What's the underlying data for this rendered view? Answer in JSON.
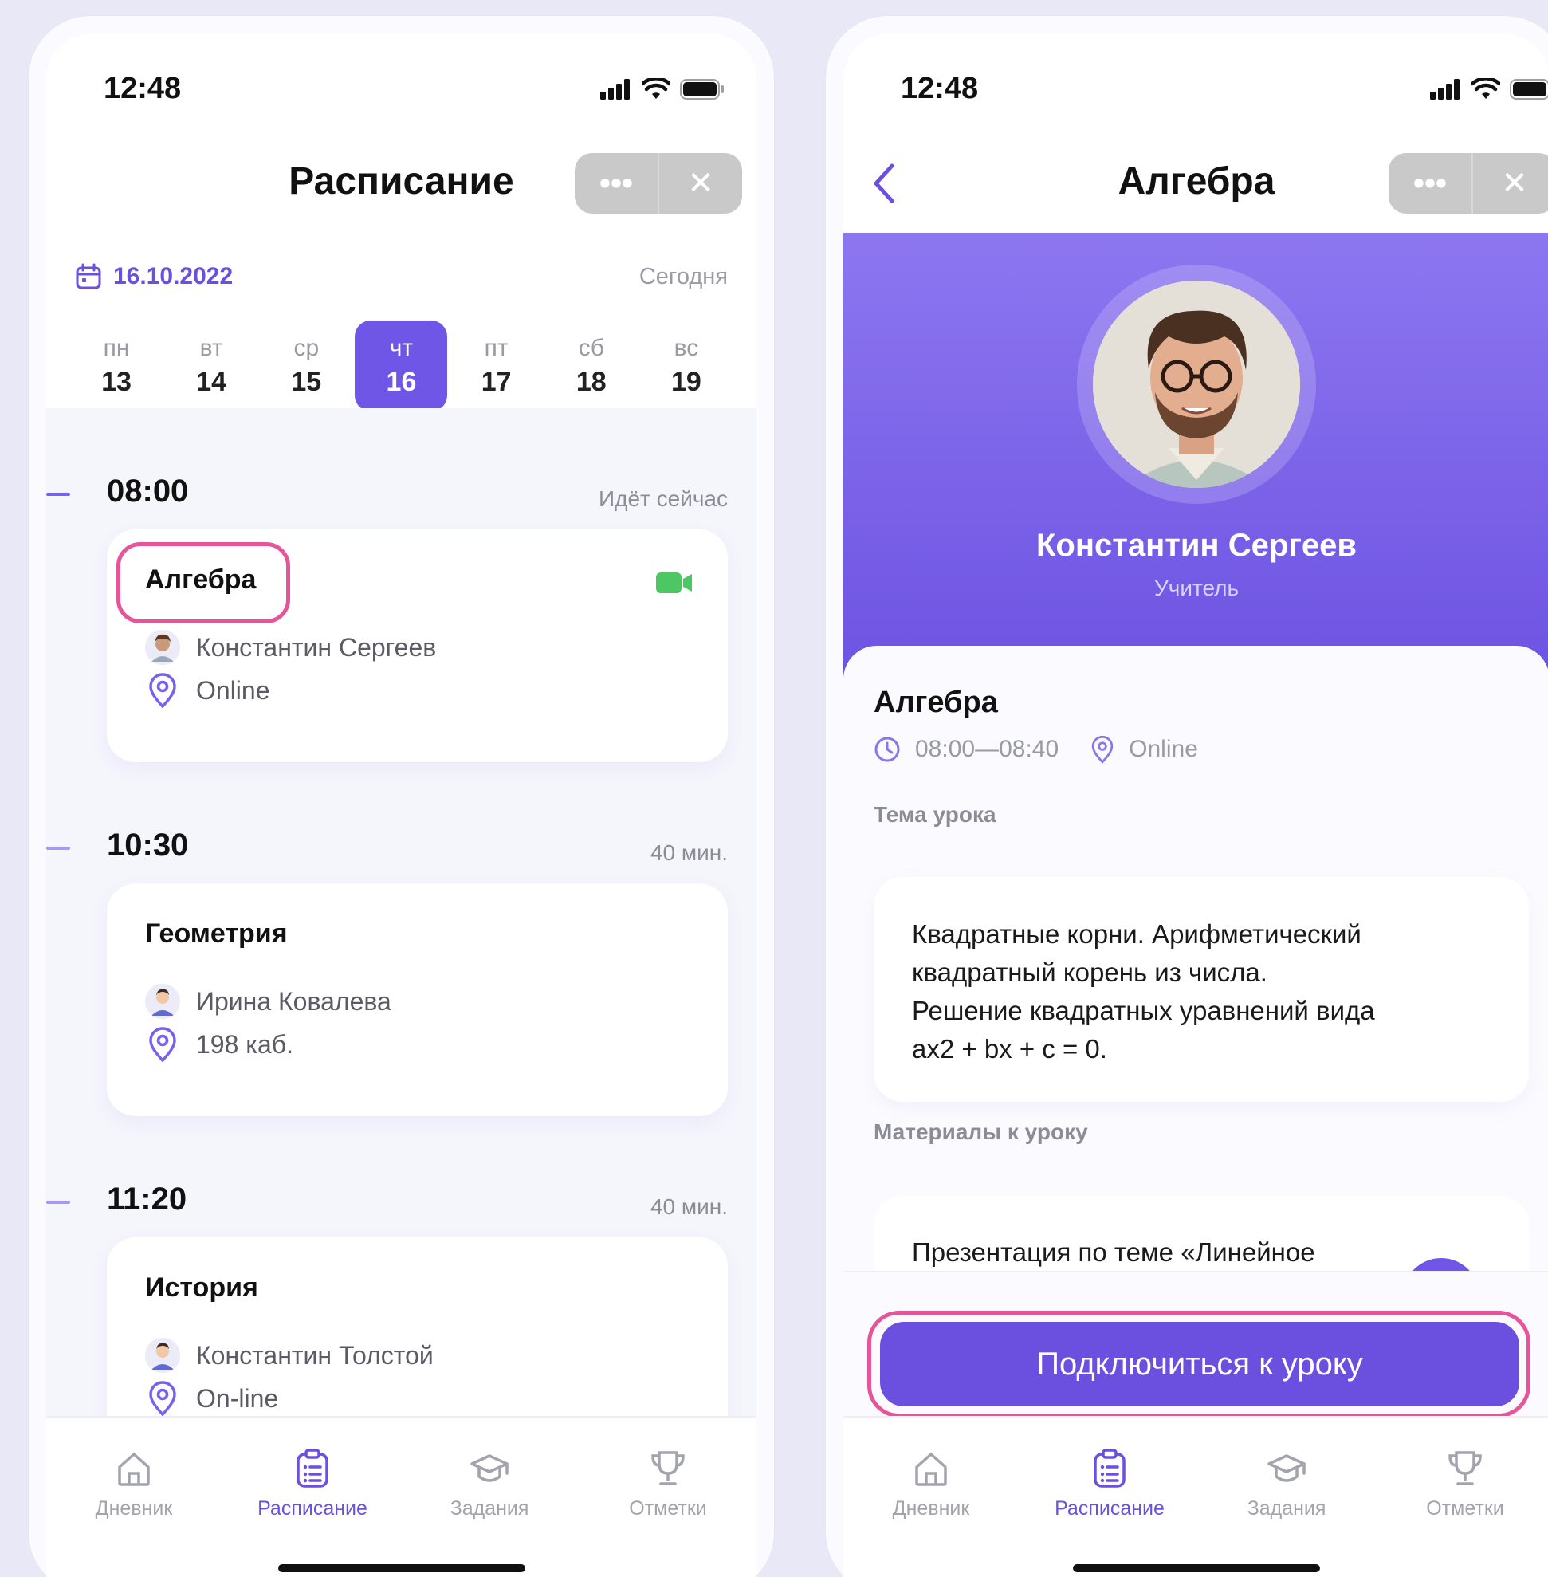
{
  "left": {
    "status_time": "12:48",
    "title": "Расписание",
    "capsule_more": "•••",
    "capsule_close": "✕",
    "date": "16.10.2022",
    "today_label": "Сегодня",
    "days": [
      {
        "name": "пн",
        "num": "13"
      },
      {
        "name": "вт",
        "num": "14"
      },
      {
        "name": "ср",
        "num": "15"
      },
      {
        "name": "чт",
        "num": "16"
      },
      {
        "name": "пт",
        "num": "17"
      },
      {
        "name": "сб",
        "num": "18"
      },
      {
        "name": "вс",
        "num": "19"
      }
    ],
    "active_day_index": 3,
    "slots": [
      {
        "time": "08:00",
        "status": "Идёт сейчас",
        "subject": "Алгебра",
        "teacher": "Константин Сергеев",
        "place": "Online"
      },
      {
        "time": "10:30",
        "status": "40 мин.",
        "subject": "Геометрия",
        "teacher": "Ирина Ковалева",
        "place": "198 каб."
      },
      {
        "time": "11:20",
        "status": "40 мин.",
        "subject": "История",
        "teacher": "Константин Толстой",
        "place": "On-line"
      }
    ]
  },
  "right": {
    "status_time": "12:48",
    "title": "Алгебра",
    "capsule_more": "•••",
    "capsule_close": "✕",
    "teacher_name": "Константин Сергеев",
    "teacher_role": "Учитель",
    "subject": "Алгебра",
    "time_range": "08:00—08:40",
    "place": "Online",
    "topic_label": "Тема урока",
    "topic_text": "Квадратные корни. Арифметический\nквадратный корень из числа.\nРешение квадратных уравнений вида\nax2 + bx + c = 0.",
    "materials_label": "Материалы к уроку",
    "material_title": "Презентация по теме «Линейное",
    "connect_button": "Подключиться к уроку"
  },
  "tabs": [
    {
      "label": "Дневник",
      "icon": "home-icon"
    },
    {
      "label": "Расписание",
      "icon": "schedule-icon"
    },
    {
      "label": "Задания",
      "icon": "graduation-cap-icon"
    },
    {
      "label": "Отметки",
      "icon": "trophy-icon"
    }
  ],
  "colors": {
    "accent": "#6B50E0",
    "highlight": "#E6559A",
    "video_green": "#4CC764"
  }
}
